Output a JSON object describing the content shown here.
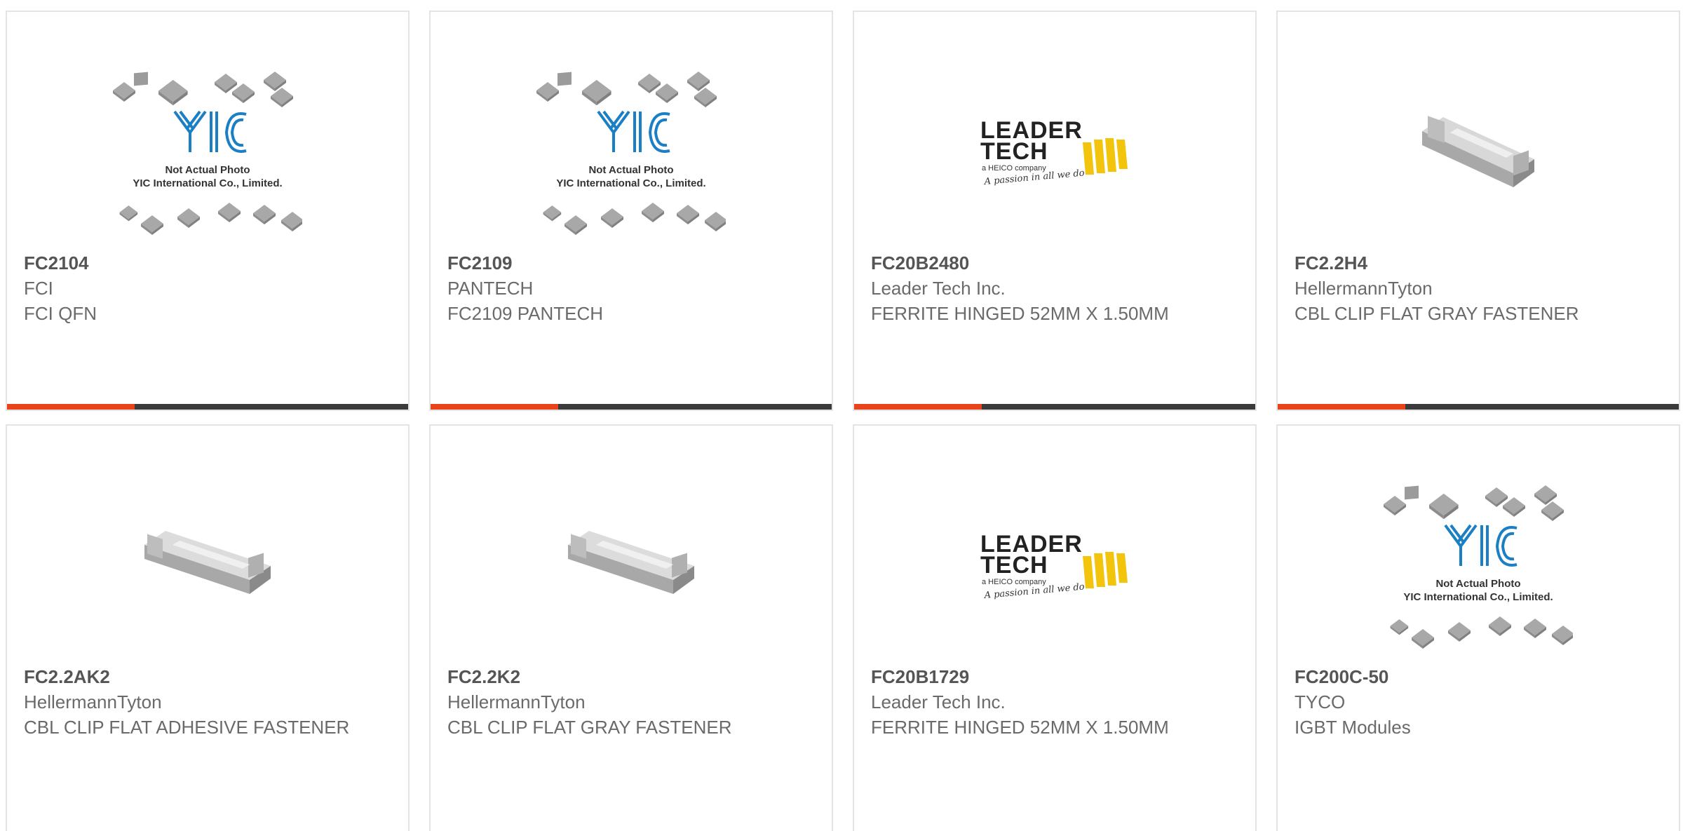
{
  "colors": {
    "accent_red": "#e8431b",
    "accent_dark": "#3b3b3b",
    "text": "#6a6a6a",
    "logo_blue": "#1a7fc4",
    "logo_yellow": "#f2c40c"
  },
  "yic_placeholder": {
    "line1": "Not Actual Photo",
    "line2": "YIC International Co., Limited."
  },
  "leadertech_logo": {
    "line1": "LEADER",
    "line2": "TECH",
    "sub": "a HEICO company",
    "tagline": "A passion in all we do"
  },
  "products": [
    {
      "part": "FC2104",
      "manufacturer": "FCI",
      "description": "FCI QFN",
      "image": "yic-placeholder"
    },
    {
      "part": "FC2109",
      "manufacturer": "PANTECH",
      "description": "FC2109 PANTECH",
      "image": "yic-placeholder"
    },
    {
      "part": "FC20B2480",
      "manufacturer": "Leader Tech Inc.",
      "description": "FERRITE HINGED 52MM X 1.50MM",
      "image": "leadertech-logo"
    },
    {
      "part": "FC2.2H4",
      "manufacturer": "HellermannTyton",
      "description": "CBL CLIP FLAT GRAY FASTENER",
      "image": "cable-clip-photo"
    },
    {
      "part": "FC2.2AK2",
      "manufacturer": "HellermannTyton",
      "description": "CBL CLIP FLAT ADHESIVE FASTENER",
      "image": "cable-clip-photo"
    },
    {
      "part": "FC2.2K2",
      "manufacturer": "HellermannTyton",
      "description": "CBL CLIP FLAT GRAY FASTENER",
      "image": "cable-clip-photo"
    },
    {
      "part": "FC20B1729",
      "manufacturer": "Leader Tech Inc.",
      "description": "FERRITE HINGED 52MM X 1.50MM",
      "image": "leadertech-logo"
    },
    {
      "part": "FC200C-50",
      "manufacturer": "TYCO",
      "description": "IGBT Modules",
      "image": "yic-placeholder"
    }
  ]
}
